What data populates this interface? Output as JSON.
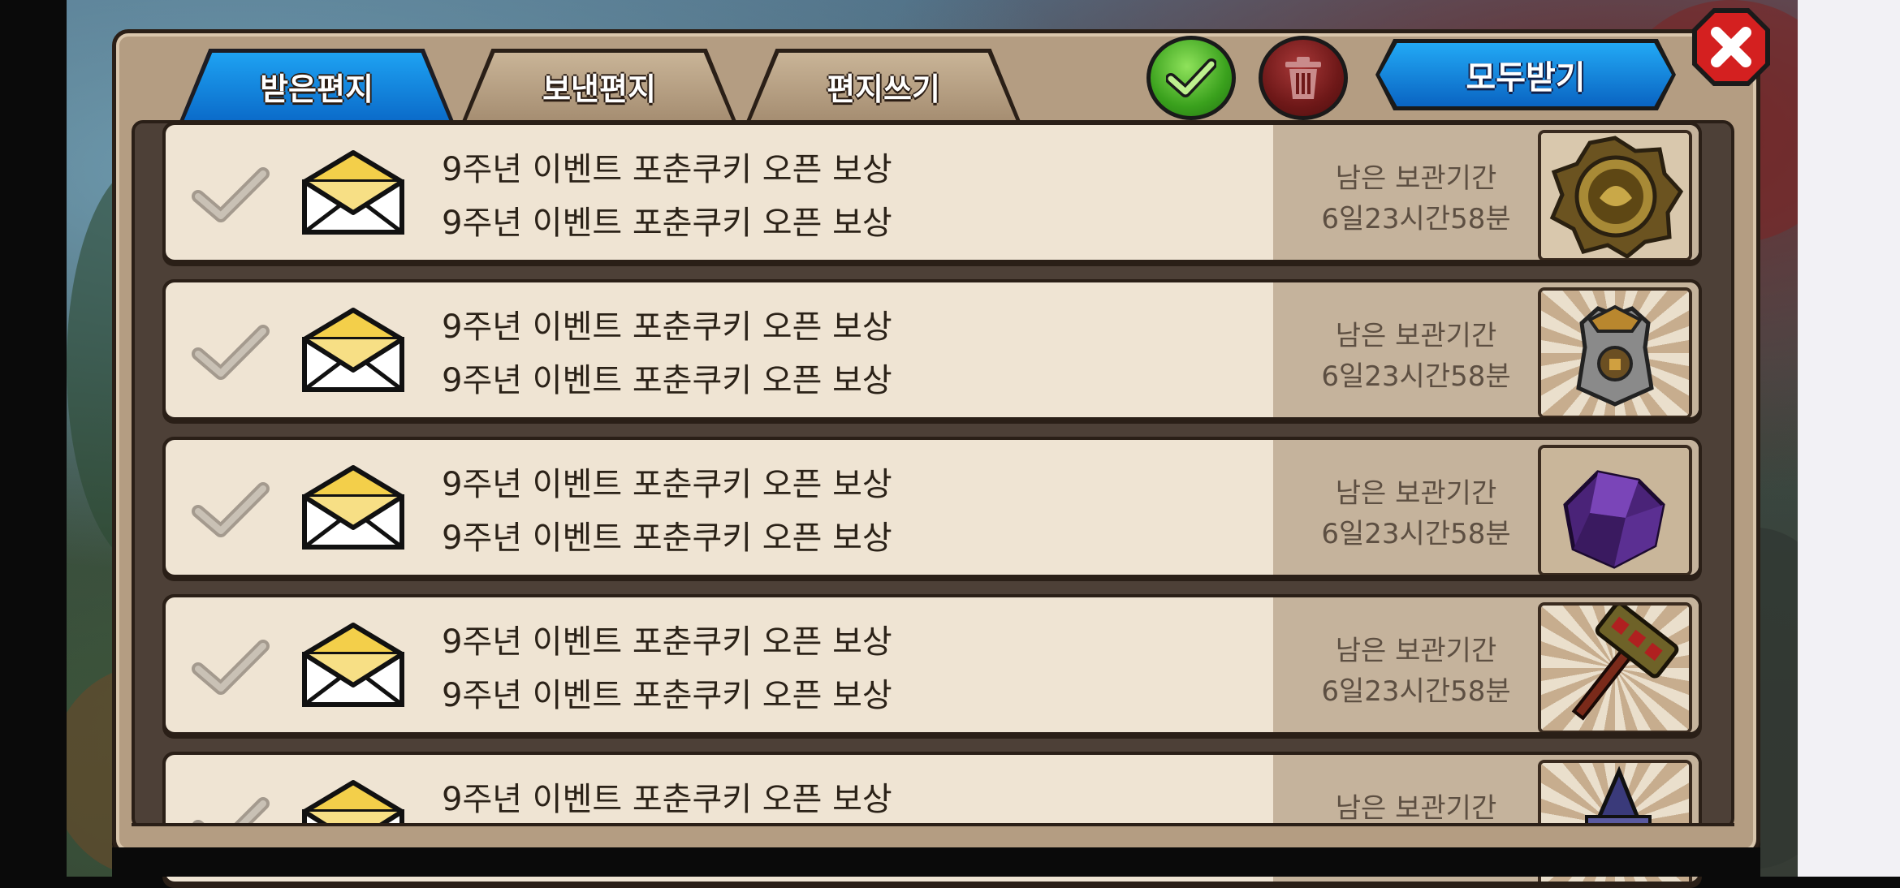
{
  "tabs": [
    {
      "label": "받은편지",
      "active": true
    },
    {
      "label": "보낸편지",
      "active": false
    },
    {
      "label": "편지쓰기",
      "active": false
    }
  ],
  "toolbar": {
    "receive_all_label": "모두받기",
    "check_all_icon": "checkmark-icon",
    "delete_icon": "trash-icon",
    "close_icon": "close-x-icon"
  },
  "mails": [
    {
      "title": "9주년 이벤트 포춘쿠키 오픈 보상",
      "subtitle": "9주년 이벤트 포춘쿠키 오픈 보상",
      "keep_label": "남은 보관기간",
      "keep_time": "6일23시간58분",
      "item_icon": "gold-medallion-icon"
    },
    {
      "title": "9주년 이벤트 포춘쿠키 오픈 보상",
      "subtitle": "9주년 이벤트 포춘쿠키 오픈 보상",
      "keep_label": "남은 보관기간",
      "keep_time": "6일23시간58분",
      "item_icon": "armor-chestplate-icon"
    },
    {
      "title": "9주년 이벤트 포춘쿠키 오픈 보상",
      "subtitle": "9주년 이벤트 포춘쿠키 오픈 보상",
      "keep_label": "남은 보관기간",
      "keep_time": "6일23시간58분",
      "item_icon": "purple-crystal-icon"
    },
    {
      "title": "9주년 이벤트 포춘쿠키 오픈 보상",
      "subtitle": "9주년 이벤트 포춘쿠키 오픈 보상",
      "keep_label": "남은 보관기간",
      "keep_time": "6일23시간58분",
      "item_icon": "hammer-weapon-icon"
    },
    {
      "title": "9주년 이벤트 포춘쿠키 오픈 보상",
      "keep_label": "남은 보관기간",
      "item_icon": "wizard-hat-icon"
    }
  ],
  "colors": {
    "tab_active": "#1a8fe6",
    "receive_all": "#1478d4",
    "check_all": "#3aa11d",
    "delete": "#7a1c1c",
    "close": "#d42020",
    "row_bg": "#efe4d3",
    "row_side": "#c5b39c"
  }
}
